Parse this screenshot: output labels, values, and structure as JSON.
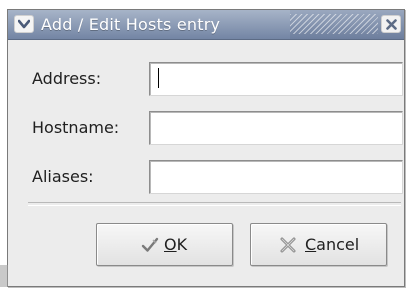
{
  "window": {
    "title": "Add / Edit Hosts entry"
  },
  "form": {
    "address_label": "Address:",
    "address_value": "",
    "hostname_label": "Hostname:",
    "hostname_value": "",
    "aliases_label": "Aliases:",
    "aliases_value": ""
  },
  "buttons": {
    "ok_mnemonic": "O",
    "ok_rest": "K",
    "cancel_mnemonic": "C",
    "cancel_rest": "ancel"
  },
  "icons": {
    "menu": "chevron-down-icon",
    "close": "close-icon",
    "ok": "checkmark-pencil-icon",
    "cancel": "x-cancel-icon"
  },
  "colors": {
    "titlebar": "#7a8aa8",
    "title_text": "#ffffff",
    "dialog_bg": "#ececec",
    "field_bg": "#ffffff"
  }
}
